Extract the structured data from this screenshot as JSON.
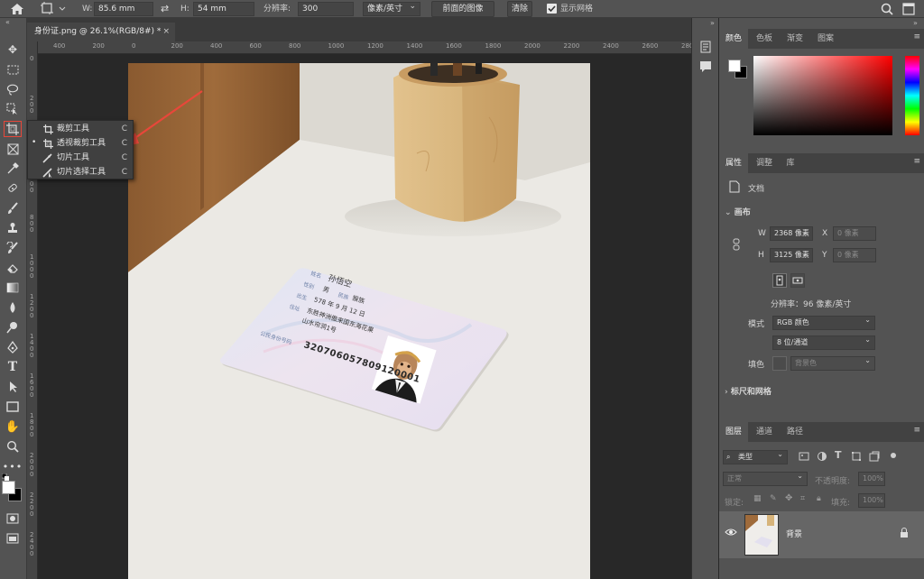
{
  "options_bar": {
    "w_label": "W:",
    "w_value": "85.6 mm",
    "h_label": "H:",
    "h_value": "54 mm",
    "resolution_label": "分辨率:",
    "resolution_value": "300",
    "unit_value": "像素/英寸",
    "front_image_label": "前面的图像",
    "clear_label": "清除",
    "show_grid_label": "显示网格"
  },
  "document": {
    "tab_title": "身份证.png @ 26.1%(RGB/8#) *",
    "ruler_h": [
      "400",
      "200",
      "0",
      "200",
      "400",
      "600",
      "800",
      "1000",
      "1200",
      "1400",
      "1600",
      "1800",
      "2000",
      "2200",
      "2400",
      "2600",
      "2800"
    ],
    "ruler_v": [
      "0",
      "200",
      "400",
      "600",
      "800",
      "1000",
      "1200",
      "1400",
      "1600",
      "1800",
      "2000",
      "2200",
      "2400"
    ]
  },
  "flyout": {
    "items": [
      {
        "label": "裁剪工具",
        "shortcut": "C",
        "icon": "crop-icon"
      },
      {
        "label": "透视裁剪工具",
        "shortcut": "C",
        "icon": "perspective-crop-icon"
      },
      {
        "label": "切片工具",
        "shortcut": "C",
        "icon": "slice-icon"
      },
      {
        "label": "切片选择工具",
        "shortcut": "C",
        "icon": "slice-select-icon"
      }
    ]
  },
  "id_card": {
    "name_label": "姓名",
    "name": "孙悟空",
    "sex_label": "性别",
    "sex": "男",
    "nation_label": "民族",
    "nation": "猴族",
    "birth_label": "出生",
    "birth": "578 年 9 月 12 日",
    "address_label": "住址",
    "address_line1": "东胜神洲傲来国东海花果",
    "address_line2": "山水帘洞1号",
    "id_label": "公民身份号码",
    "id_number": "320706057809120001"
  },
  "color_panel": {
    "tabs": [
      "颜色",
      "色板",
      "渐变",
      "图案"
    ]
  },
  "properties_panel": {
    "tabs": [
      "属性",
      "调整",
      "库"
    ],
    "doc_label": "文档",
    "canvas_section": "画布",
    "w_label": "W",
    "w_value": "2368 像素",
    "h_label": "H",
    "h_value": "3125 像素",
    "x_label": "X",
    "x_placeholder": "0 像素",
    "y_label": "Y",
    "y_placeholder": "0 像素",
    "resolution_text": "分辨率：96 像素/英寸",
    "mode_label": "模式",
    "mode_value": "RGB 颜色",
    "depth_value": "8 位/通道",
    "fill_label": "填色",
    "fill_value": "背景色",
    "rulers_section": "标尺和网格"
  },
  "layers_panel": {
    "tabs": [
      "图层",
      "通道",
      "路径"
    ],
    "filter_label": "类型",
    "blend_mode": "正常",
    "opacity_label": "不透明度:",
    "opacity_value": "100%",
    "lock_label": "锁定:",
    "fill_label": "填充:",
    "fill_value": "100%",
    "layer_name": "背景"
  },
  "colors": {
    "accent_red": "#e8473a",
    "panel": "#535353"
  }
}
